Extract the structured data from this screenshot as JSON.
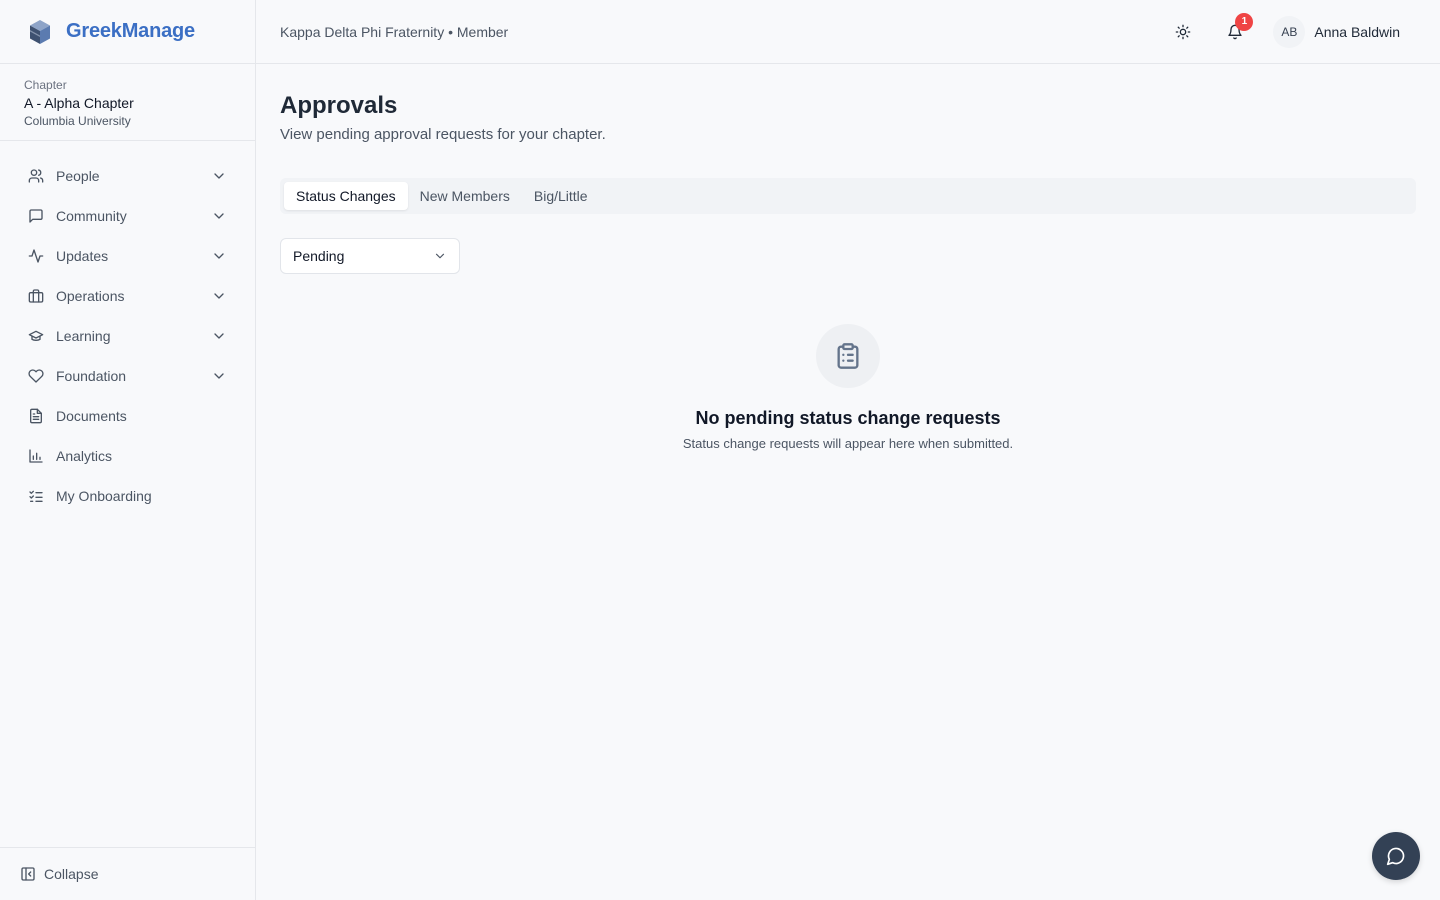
{
  "brand": {
    "name": "GreekManage",
    "color": "#3b6fc4"
  },
  "chapter": {
    "label": "Chapter",
    "name": "A - Alpha Chapter",
    "university": "Columbia University"
  },
  "nav": {
    "items": [
      {
        "label": "People",
        "icon": "users-icon",
        "expandable": true
      },
      {
        "label": "Community",
        "icon": "message-square-icon",
        "expandable": true
      },
      {
        "label": "Updates",
        "icon": "activity-icon",
        "expandable": true
      },
      {
        "label": "Operations",
        "icon": "briefcase-icon",
        "expandable": true
      },
      {
        "label": "Learning",
        "icon": "graduation-cap-icon",
        "expandable": true
      },
      {
        "label": "Foundation",
        "icon": "heart-icon",
        "expandable": true
      },
      {
        "label": "Documents",
        "icon": "file-text-icon",
        "expandable": false
      },
      {
        "label": "Analytics",
        "icon": "bar-chart-icon",
        "expandable": false
      },
      {
        "label": "My Onboarding",
        "icon": "list-checks-icon",
        "expandable": false
      }
    ],
    "collapse_label": "Collapse"
  },
  "topbar": {
    "org": "Kappa Delta Phi Fraternity • Member",
    "notification_count": "1",
    "user": {
      "initials": "AB",
      "name": "Anna Baldwin"
    }
  },
  "page": {
    "title": "Approvals",
    "subtitle": "View pending approval requests for your chapter.",
    "tabs": [
      "Status Changes",
      "New Members",
      "Big/Little"
    ],
    "active_tab": "Status Changes",
    "filter": {
      "selected": "Pending"
    },
    "empty": {
      "title": "No pending status change requests",
      "subtitle": "Status change requests will appear here when submitted."
    }
  },
  "colors": {
    "badge": "#ef4444",
    "fab": "#334155"
  }
}
